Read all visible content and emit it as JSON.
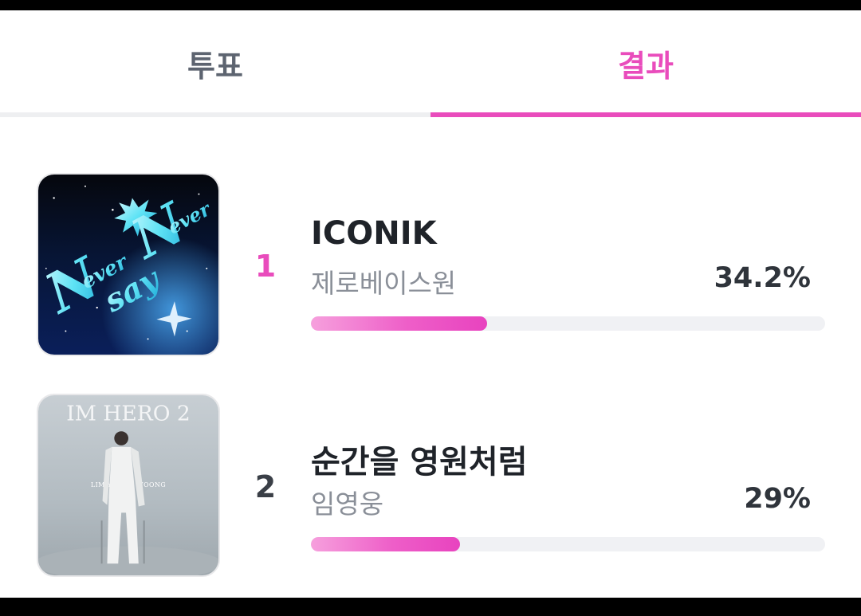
{
  "tabs": [
    {
      "label": "투표",
      "active": false
    },
    {
      "label": "결과",
      "active": true
    }
  ],
  "results": [
    {
      "rank": "1",
      "title": "ICONIK",
      "artist": "제로베이스원",
      "percent_label": "34.2%",
      "percent": 34.2,
      "cover_icon": "album-cover-never-say-never"
    },
    {
      "rank": "2",
      "title": "순간을 영원처럼",
      "artist": "임영웅",
      "percent_label": "29%",
      "percent": 29,
      "cover_icon": "album-cover-im-hero-2",
      "cover_text": {
        "album": "IM HERO 2",
        "artist": "LIM YOUNG WOONG"
      }
    }
  ],
  "colors": {
    "accent": "#e94cbc",
    "bar_track": "#f0f1f4",
    "inactive_tab": "#5d6470"
  }
}
